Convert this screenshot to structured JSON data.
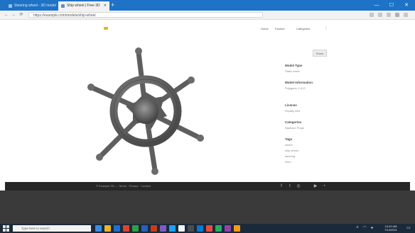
{
  "browser": {
    "tabs": [
      {
        "label": "Steering wheel - 3D model"
      },
      {
        "label": "Ship wheel | Free 3D"
      }
    ],
    "new_tab": "+",
    "address": "https://example.com/models/ship-wheel",
    "nav": {
      "back": "←",
      "forward": "→",
      "refresh": "⟳"
    },
    "window": {
      "min": "—",
      "max": "☐",
      "close": "✕"
    }
  },
  "site": {
    "nav": [
      "Home",
      "Explore",
      "Categories"
    ],
    "more": "⋮",
    "side_button": "Share"
  },
  "meta": [
    {
      "label": "Model Type",
      "value": "Static mesh"
    },
    {
      "label": "Model Information",
      "value": "Polygons: 2,312"
    },
    {
      "label": "License",
      "value": "Royalty free"
    },
    {
      "label": "Categories",
      "value": "Nautical, Props"
    },
    {
      "label": "Tags",
      "values": [
        "wheel",
        "ship wheel",
        "steering",
        "helm"
      ]
    }
  ],
  "footer": {
    "text": "© Example 3D — Terms · Privacy · Contact",
    "icons": [
      "facebook-icon",
      "twitter-icon",
      "instagram-icon",
      "youtube-icon",
      "rss-icon"
    ]
  },
  "taskbar": {
    "search_placeholder": "Type here to search",
    "time": "10:42 AM",
    "date": "7/14/2021"
  },
  "colors": {
    "titlebar": "#1e73c7",
    "footer": "#262626",
    "taskbar": "#1b2a3a",
    "wheel": "#6b6b6b"
  }
}
